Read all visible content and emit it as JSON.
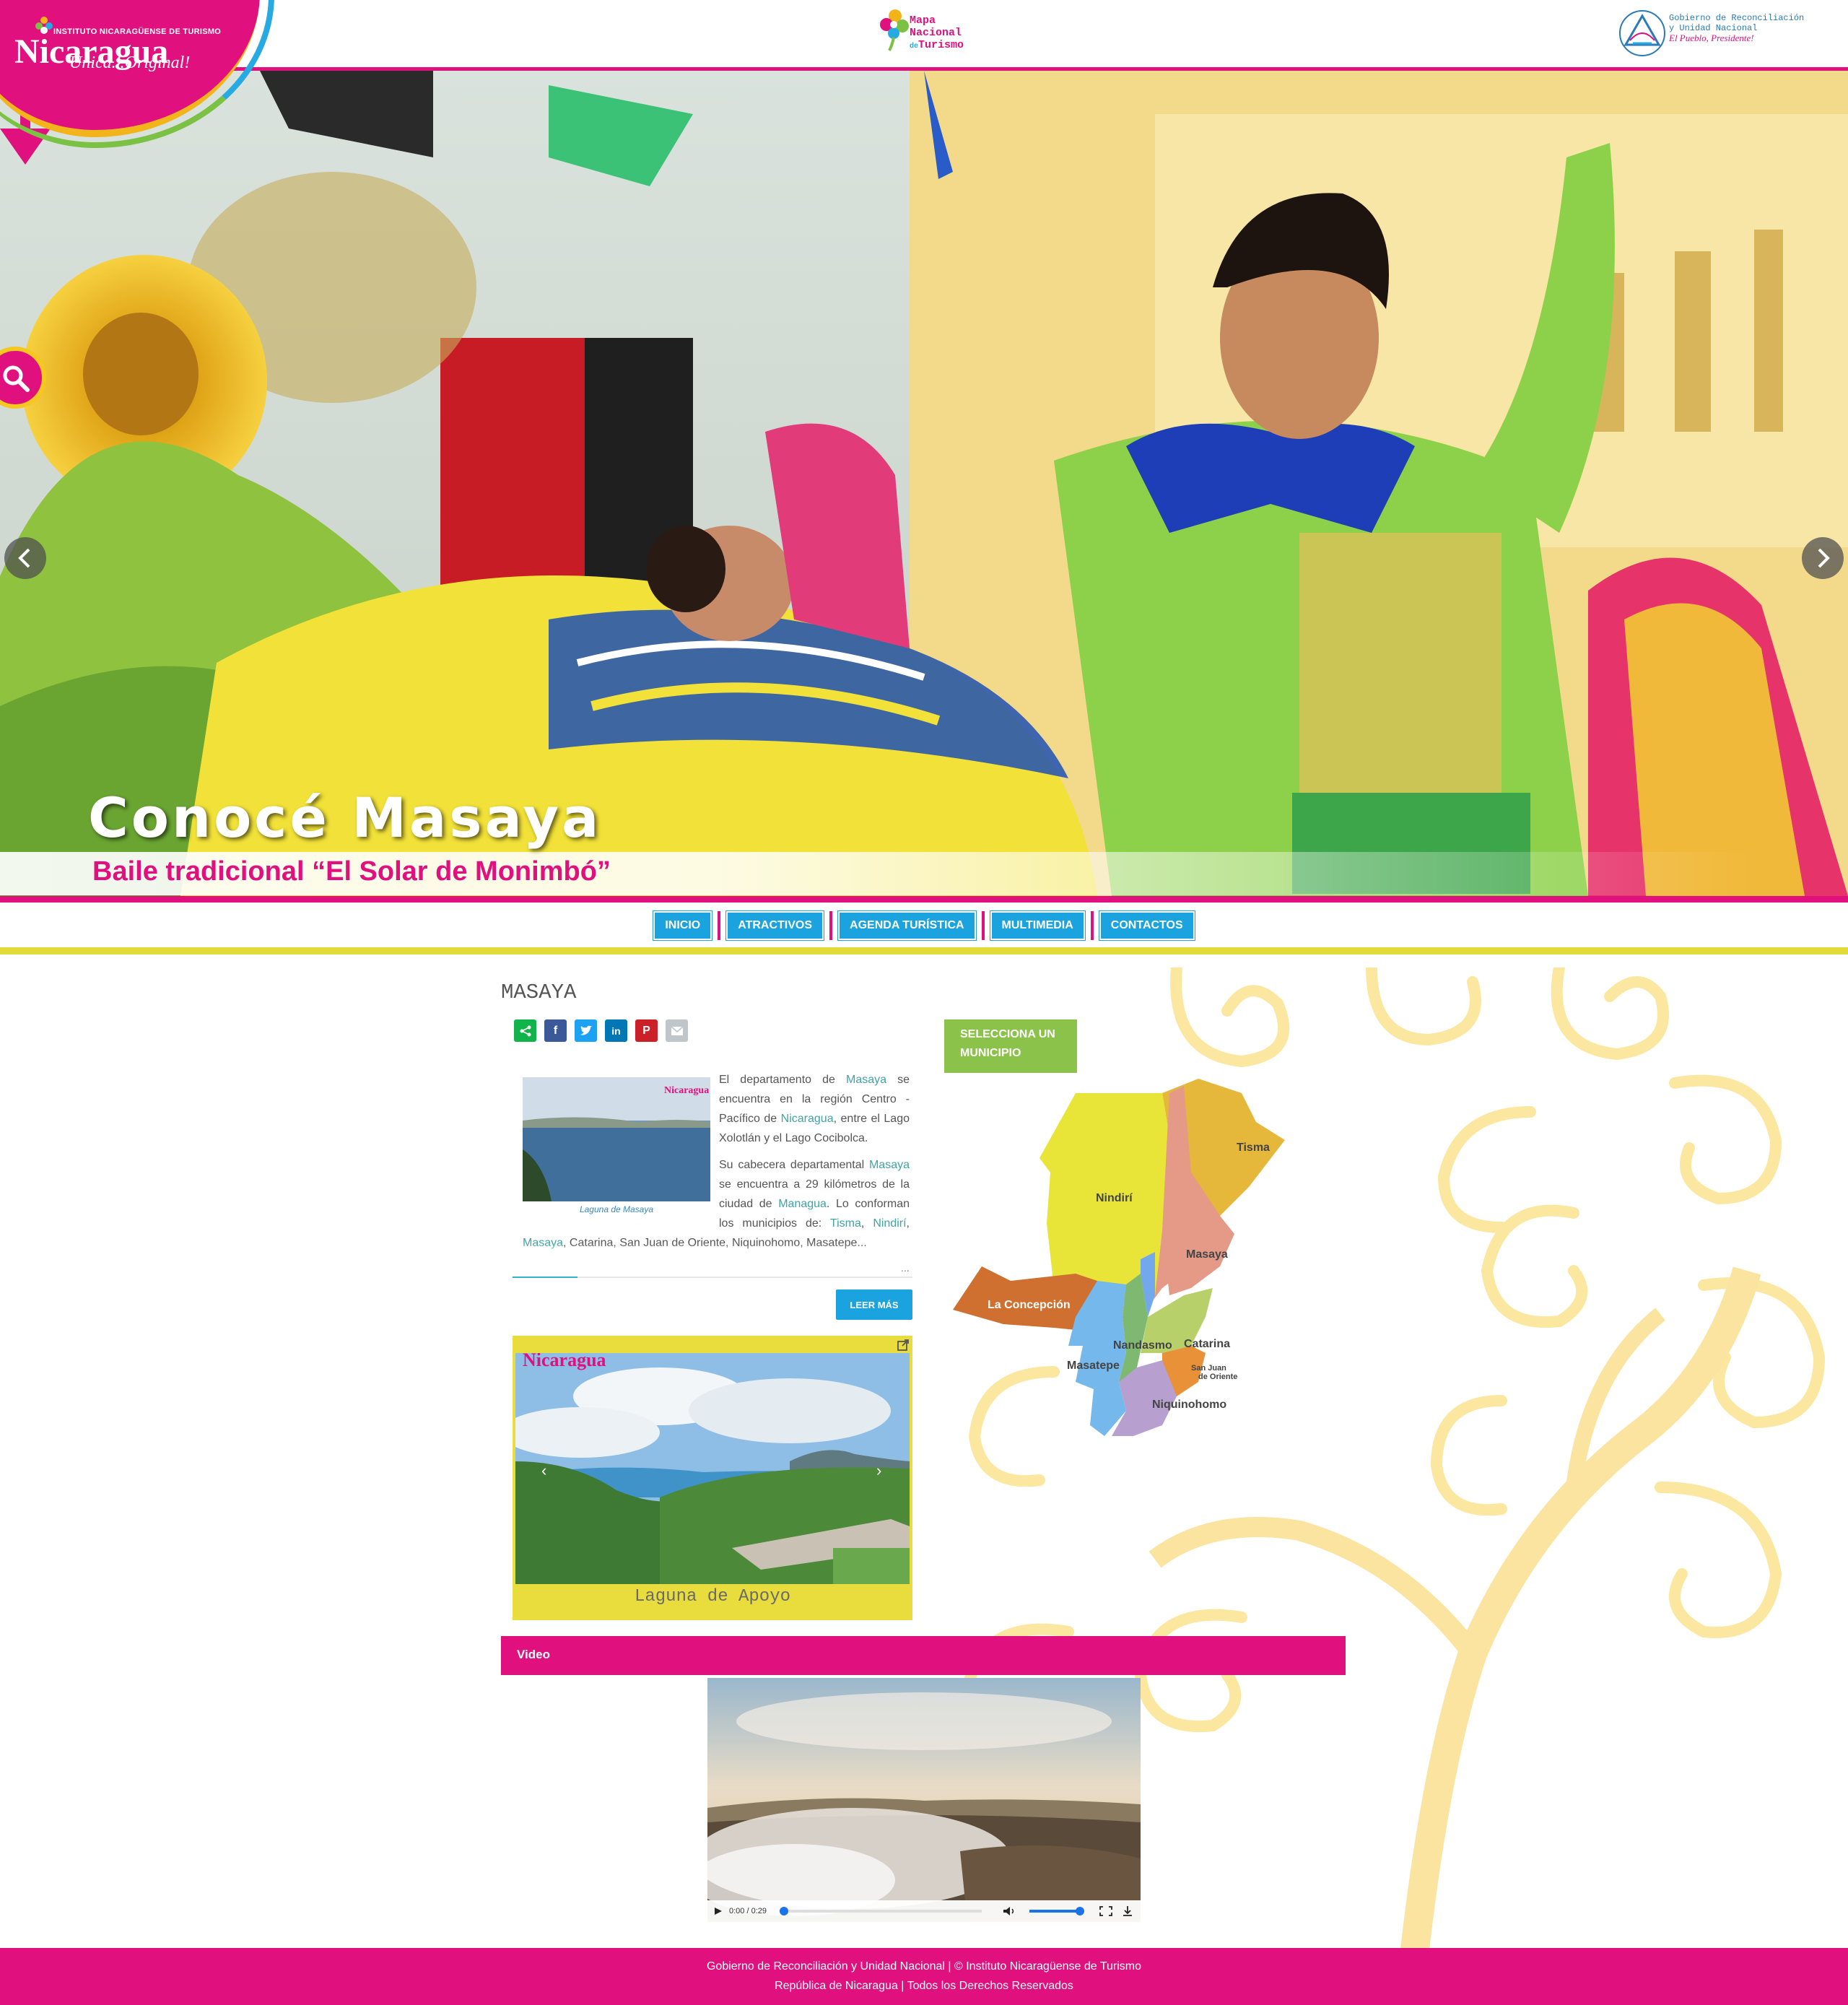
{
  "header": {
    "left_logo": {
      "institute": "INSTITUTO NICARAGÜENSE DE TURISMO",
      "name": "Nicaragua",
      "tagline": "Única...Original!"
    },
    "center_logo": {
      "line1": "Mapa",
      "line2": "Nacional",
      "line3_prefix": "de",
      "line3": "Turismo"
    },
    "right_logo": {
      "line1": "Gobierno de Reconciliación",
      "line2": "y Unidad Nacional",
      "line3": "El Pueblo, Presidente!"
    }
  },
  "hero": {
    "title": "Conocé Masaya",
    "subtitle": "Baile tradicional “El Solar de Monimbó”"
  },
  "nav": {
    "items": [
      "INICIO",
      "ATRACTIVOS",
      "AGENDA TURÍSTICA",
      "MULTIMEDIA",
      "CONTACTOS"
    ]
  },
  "page": {
    "title": "MASAYA"
  },
  "article": {
    "thumb_caption": "Laguna de Masaya",
    "p1_a": "El departamento de ",
    "p1_link1": "Masaya",
    "p1_b": " se encuentra en la región Centro - Pacífico de ",
    "p1_link2": "Nicaragua",
    "p1_c": ", entre el Lago Xolotlán y el Lago Cocibolca.",
    "p2_a": "Su cabecera departamental ",
    "p2_link1": "Masaya",
    "p2_b": " se encuentra a 29 kilómetros de la ciudad de ",
    "p2_link2": "Managua",
    "p2_c": ". Lo conforman los municipios de: ",
    "p2_link3": "Tisma",
    "p2_sep1": ", ",
    "p2_link4": "Nindirí",
    "p2_sep2": ", ",
    "p2_link5": "Masaya",
    "p2_d": ", Catarina, San Juan de Oriente, Niquinohomo, Masatepe...",
    "ellipsis": "...",
    "read_more": "LEER MÁS"
  },
  "gallery": {
    "caption": "Laguna de Apoyo",
    "watermark": "Nicaragua"
  },
  "municipio": {
    "select_label_1": "SELECCIONA UN",
    "select_label_2": "MUNICIPIO",
    "regions": [
      "Tisma",
      "Nindirí",
      "Masaya",
      "La Concepción",
      "Nandasmo",
      "Catarina",
      "Masatepe",
      "San Juan",
      "de Oriente",
      "Niquinohomo"
    ]
  },
  "video": {
    "heading": "Video",
    "time": "0:00 / 0:29"
  },
  "footer": {
    "line1": "Gobierno de Reconciliación y Unidad Nacional |  © Instituto Nicaragüense de Turismo",
    "line2": "República de Nicaragua |  Todos los Derechos Reservados"
  },
  "colors": {
    "magenta": "#e0107e",
    "blue": "#1ba3e0",
    "yellow": "#e2da3a",
    "green": "#8bc34a"
  }
}
